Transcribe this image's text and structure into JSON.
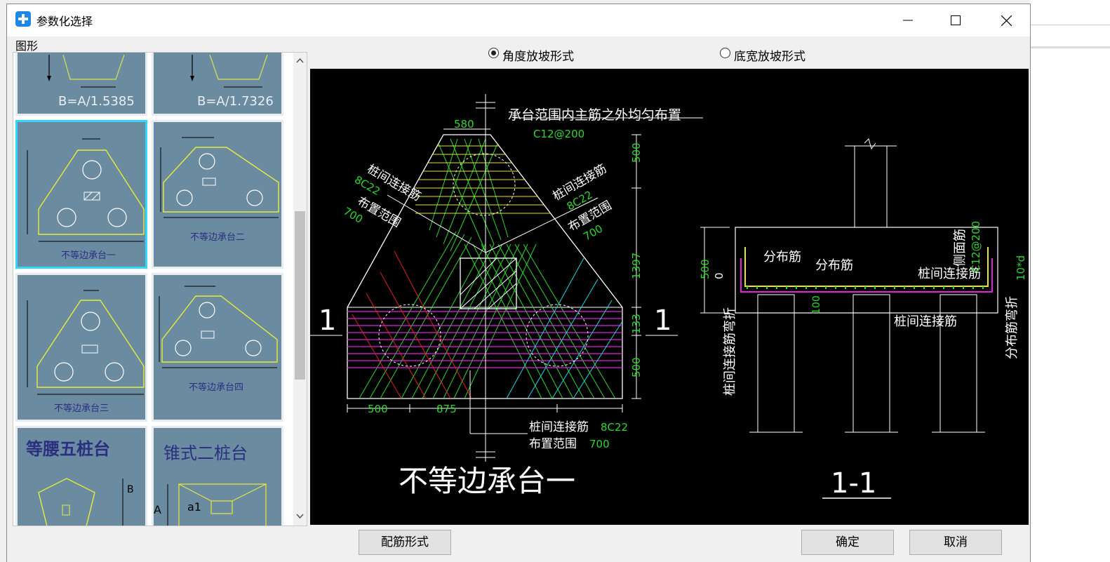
{
  "window": {
    "title": "参数化选择"
  },
  "left": {
    "header": "图形",
    "thumbs": [
      {
        "caption": "B=A/1.5385"
      },
      {
        "caption": "B=A/1.7326"
      },
      {
        "caption": "不等边承台一"
      },
      {
        "caption": "不等边承台二"
      },
      {
        "caption": "不等边承台三"
      },
      {
        "caption": "不等边承台四"
      },
      {
        "caption": "等腰五桩台"
      },
      {
        "caption": "锥式二桩台"
      }
    ]
  },
  "options": {
    "angle_label": "角度放坡形式",
    "width_label": "底宽放坡形式",
    "selected": "角度放坡形式"
  },
  "drawing": {
    "title": "不等边承台一",
    "note_top": "承台范围内主筋之外均匀布置",
    "c12": "C12@200",
    "d580": "580",
    "d500a": "500",
    "d1397": "1397",
    "d133": "133",
    "d500b": "500",
    "d500c": "500",
    "d875": "875",
    "left_label1": "桩间连接筋",
    "left_label2": "8C22",
    "left_label3": "布置范围",
    "left_label4": "700",
    "right_label1": "桩间连接筋",
    "right_label2": "8C22",
    "right_label3": "布置范围",
    "right_label4": "700",
    "bottom_label1": "桩间连接筋",
    "bottom_label2": "8C22",
    "bottom_label3": "布置范围",
    "bottom_label4": "700",
    "section_mark": "1",
    "section_title": "1-1",
    "sec_fenbu1": "分布筋",
    "sec_fenbu2": "分布筋",
    "sec_cemian": "侧面筋",
    "sec_c12": "C12@200",
    "sec_zhuangjian": "桩间连接筋",
    "sec_zhuangjian2": "桩间连接筋",
    "sec_left_vert": "桩间连接筋弯折",
    "sec_right_vert": "分布筋弯折",
    "sec_10d": "10*d",
    "sec_500": "500",
    "sec_0": "0",
    "sec_100": "100"
  },
  "buttons": {
    "rebar": "配筋形式",
    "ok": "确定",
    "cancel": "取消"
  },
  "colors": {
    "thumb_bg": "#6b8ba0",
    "selected_border": "#33d6ff",
    "canvas_bg": "#000000"
  }
}
